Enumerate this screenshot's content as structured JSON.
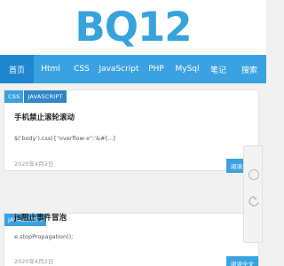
{
  "brand": {
    "logo_text": "BQ12"
  },
  "nav": {
    "items": [
      {
        "label": "首页",
        "active": true
      },
      {
        "label": "Html"
      },
      {
        "label": "CSS"
      },
      {
        "label": "JavaScript"
      },
      {
        "label": "PHP"
      },
      {
        "label": "MySql"
      },
      {
        "label": "笔记"
      },
      {
        "label": "搜索"
      }
    ]
  },
  "posts": [
    {
      "tags": [
        "CSS",
        "JAVASCRIPT"
      ],
      "title": "手机禁止滚轮滚动",
      "excerpt": "$('body').css({\"overflow-x\":'&#[...]",
      "date": "2020年4月2日",
      "read_more": "阅读全文"
    },
    {
      "tags": [
        "JAVASCRIPT"
      ],
      "title": "js阻止事件冒泡",
      "excerpt": "e.stopPropagation();",
      "date": "2020年4月2日",
      "read_more": "阅读全文"
    }
  ],
  "floating_tools": {
    "icons": [
      "circle-icon",
      "refresh-icon"
    ]
  },
  "colors": {
    "accent": "#3aa2e0",
    "accent_dark": "#1f86cf",
    "logo": "#36a3dd"
  }
}
